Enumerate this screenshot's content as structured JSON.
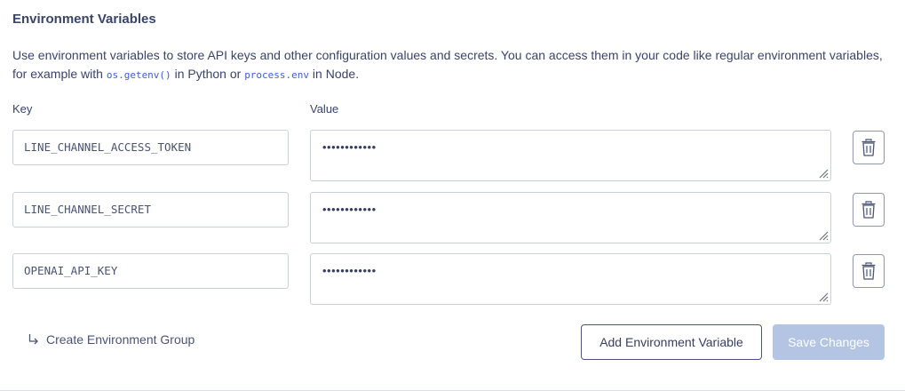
{
  "section": {
    "title": "Environment Variables",
    "desc_part1": "Use environment variables to store API keys and other configuration values and secrets. You can access them in your code like regular environment variables, for example with ",
    "code1": "os.getenv()",
    "desc_part2": " in Python or ",
    "code2": "process.env",
    "desc_part3": " in Node."
  },
  "labels": {
    "key": "Key",
    "value": "Value"
  },
  "rows": [
    {
      "key": "LINE_CHANNEL_ACCESS_TOKEN",
      "value_masked": "••••••••••••"
    },
    {
      "key": "LINE_CHANNEL_SECRET",
      "value_masked": "••••••••••••"
    },
    {
      "key": "OPENAI_API_KEY",
      "value_masked": "••••••••••••"
    }
  ],
  "footer": {
    "create_group_label": "Create Environment Group",
    "add_variable_label": "Add Environment Variable",
    "save_label": "Save Changes"
  },
  "colors": {
    "text": "#3a4468",
    "code": "#3b5fd4",
    "save_disabled_bg": "#b4c4e3",
    "border": "#c9cfdb"
  },
  "icons": {
    "delete": "trash-icon",
    "resize": "resize-grip-icon",
    "group_arrow": "arrow-turn-down-right-icon"
  }
}
